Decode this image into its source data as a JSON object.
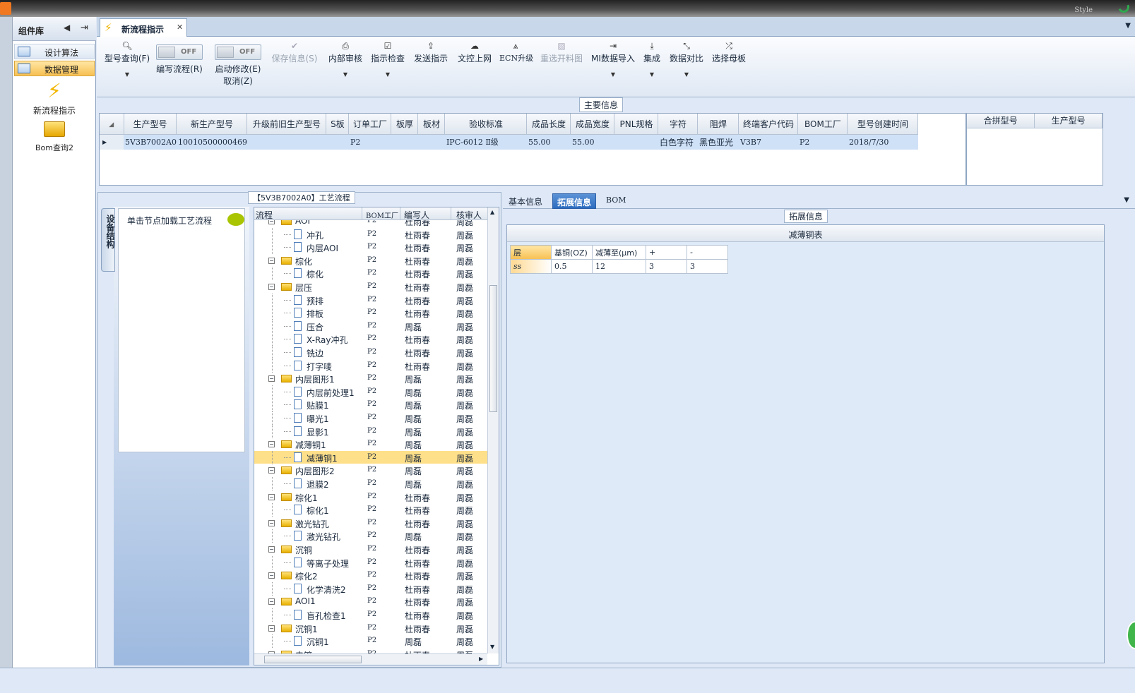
{
  "window": {
    "style_label": "Style"
  },
  "sidebar": {
    "title": "组件库",
    "items": [
      {
        "label": "设计算法"
      },
      {
        "label": "数据管理"
      }
    ],
    "big_items": [
      {
        "label": "新流程指示",
        "icon": "lightning-icon"
      },
      {
        "label": "Bom查询2",
        "icon": "folder-icon"
      }
    ]
  },
  "doc_tab": {
    "label": "新流程指示"
  },
  "toolbar": {
    "model_query": "型号查询(F)",
    "edit_flow_toggle": {
      "state": "OFF",
      "label": "编写流程(R)"
    },
    "auto_modify_toggle": {
      "state": "OFF",
      "label": "启动修改(E)",
      "sublabel": "取消(Z)"
    },
    "save_info": "保存信息(S)",
    "internal_review": "内部审核",
    "instruction_check": "指示检查",
    "send_instruction": "发送指示",
    "doc_upload": "文控上网",
    "ecn_upgrade": "ECN升级",
    "reselect_material": "重选开料图",
    "mi_import": "MI数据导入",
    "integrate": "集成",
    "data_compare": "数据对比",
    "select_master": "选择母板"
  },
  "main_info": {
    "title": "主要信息",
    "columns": [
      "生产型号",
      "新生产型号",
      "升级前旧生产型号",
      "S板",
      "订单工厂",
      "板厚",
      "板材",
      "验收标准",
      "成品长度",
      "成品宽度",
      "PNL规格",
      "字符",
      "阻焊",
      "终端客户代码",
      "BOM工厂",
      "型号创建时间"
    ],
    "rows": [
      [
        "5V3B7002A0",
        "10010500000469",
        "",
        "",
        "P2",
        "",
        "",
        "IPC-6012 Ⅱ级",
        "55.00",
        "55.00",
        "",
        "白色字符",
        "黑色亚光",
        "V3B7",
        "P2",
        "2018/7/30"
      ]
    ],
    "side_columns": [
      "合拼型号",
      "生产型号"
    ]
  },
  "process": {
    "title": "【5V3B7002A0】工艺流程",
    "vertical_tab": "设备结构",
    "hint": "单击节点加载工艺流程",
    "columns": [
      "流程",
      "BOM工厂",
      "编写人",
      "核审人"
    ],
    "rows": [
      {
        "name": "AOI",
        "level": 0,
        "factory": "P2",
        "editor": "杜雨春",
        "reviewer": "周磊"
      },
      {
        "name": "冲孔",
        "level": 1,
        "factory": "P2",
        "editor": "杜雨春",
        "reviewer": "周磊"
      },
      {
        "name": "内层AOI",
        "level": 1,
        "factory": "P2",
        "editor": "杜雨春",
        "reviewer": "周磊"
      },
      {
        "name": "棕化",
        "level": 0,
        "factory": "P2",
        "editor": "杜雨春",
        "reviewer": "周磊"
      },
      {
        "name": "棕化",
        "level": 1,
        "factory": "P2",
        "editor": "杜雨春",
        "reviewer": "周磊"
      },
      {
        "name": "层压",
        "level": 0,
        "factory": "P2",
        "editor": "杜雨春",
        "reviewer": "周磊"
      },
      {
        "name": "预排",
        "level": 1,
        "factory": "P2",
        "editor": "杜雨春",
        "reviewer": "周磊"
      },
      {
        "name": "排板",
        "level": 1,
        "factory": "P2",
        "editor": "杜雨春",
        "reviewer": "周磊"
      },
      {
        "name": "压合",
        "level": 1,
        "factory": "P2",
        "editor": "周磊",
        "reviewer": "周磊"
      },
      {
        "name": "X-Ray冲孔",
        "level": 1,
        "factory": "P2",
        "editor": "杜雨春",
        "reviewer": "周磊"
      },
      {
        "name": "铣边",
        "level": 1,
        "factory": "P2",
        "editor": "杜雨春",
        "reviewer": "周磊"
      },
      {
        "name": "打字唛",
        "level": 1,
        "factory": "P2",
        "editor": "杜雨春",
        "reviewer": "周磊"
      },
      {
        "name": "内层图形1",
        "level": 0,
        "factory": "P2",
        "editor": "周磊",
        "reviewer": "周磊"
      },
      {
        "name": "内层前处理1",
        "level": 1,
        "factory": "P2",
        "editor": "周磊",
        "reviewer": "周磊"
      },
      {
        "name": "贴膜1",
        "level": 1,
        "factory": "P2",
        "editor": "周磊",
        "reviewer": "周磊"
      },
      {
        "name": "曝光1",
        "level": 1,
        "factory": "P2",
        "editor": "周磊",
        "reviewer": "周磊"
      },
      {
        "name": "显影1",
        "level": 1,
        "factory": "P2",
        "editor": "周磊",
        "reviewer": "周磊"
      },
      {
        "name": "减薄铜1",
        "level": 0,
        "factory": "P2",
        "editor": "周磊",
        "reviewer": "周磊"
      },
      {
        "name": "减薄铜1",
        "level": 1,
        "factory": "P2",
        "editor": "周磊",
        "reviewer": "周磊",
        "selected": true
      },
      {
        "name": "内层图形2",
        "level": 0,
        "factory": "P2",
        "editor": "周磊",
        "reviewer": "周磊"
      },
      {
        "name": "退膜2",
        "level": 1,
        "factory": "P2",
        "editor": "周磊",
        "reviewer": "周磊"
      },
      {
        "name": "棕化1",
        "level": 0,
        "factory": "P2",
        "editor": "杜雨春",
        "reviewer": "周磊"
      },
      {
        "name": "棕化1",
        "level": 1,
        "factory": "P2",
        "editor": "杜雨春",
        "reviewer": "周磊"
      },
      {
        "name": "激光钻孔",
        "level": 0,
        "factory": "P2",
        "editor": "杜雨春",
        "reviewer": "周磊"
      },
      {
        "name": "激光钻孔",
        "level": 1,
        "factory": "P2",
        "editor": "周磊",
        "reviewer": "周磊"
      },
      {
        "name": "沉铜",
        "level": 0,
        "factory": "P2",
        "editor": "杜雨春",
        "reviewer": "周磊"
      },
      {
        "name": "等离子处理",
        "level": 1,
        "factory": "P2",
        "editor": "杜雨春",
        "reviewer": "周磊"
      },
      {
        "name": "棕化2",
        "level": 0,
        "factory": "P2",
        "editor": "杜雨春",
        "reviewer": "周磊"
      },
      {
        "name": "化学清洗2",
        "level": 1,
        "factory": "P2",
        "editor": "杜雨春",
        "reviewer": "周磊"
      },
      {
        "name": "AOI1",
        "level": 0,
        "factory": "P2",
        "editor": "杜雨春",
        "reviewer": "周磊"
      },
      {
        "name": "盲孔检查1",
        "level": 1,
        "factory": "P2",
        "editor": "杜雨春",
        "reviewer": "周磊"
      },
      {
        "name": "沉铜1",
        "level": 0,
        "factory": "P2",
        "editor": "杜雨春",
        "reviewer": "周磊"
      },
      {
        "name": "沉铜1",
        "level": 1,
        "factory": "P2",
        "editor": "周磊",
        "reviewer": "周磊"
      },
      {
        "name": "电镀",
        "level": 0,
        "factory": "P2",
        "editor": "杜雨春",
        "reviewer": "周磊"
      }
    ]
  },
  "right_tabs": [
    "基本信息",
    "拓展信息",
    "BOM"
  ],
  "ext": {
    "title": "拓展信息",
    "table_title": "减薄铜表",
    "columns": [
      "层",
      "基铜(OZ)",
      "减薄至(μm)",
      "+",
      "-"
    ],
    "rows": [
      [
        "ss",
        "0.5",
        "12",
        "3",
        "3"
      ]
    ]
  }
}
